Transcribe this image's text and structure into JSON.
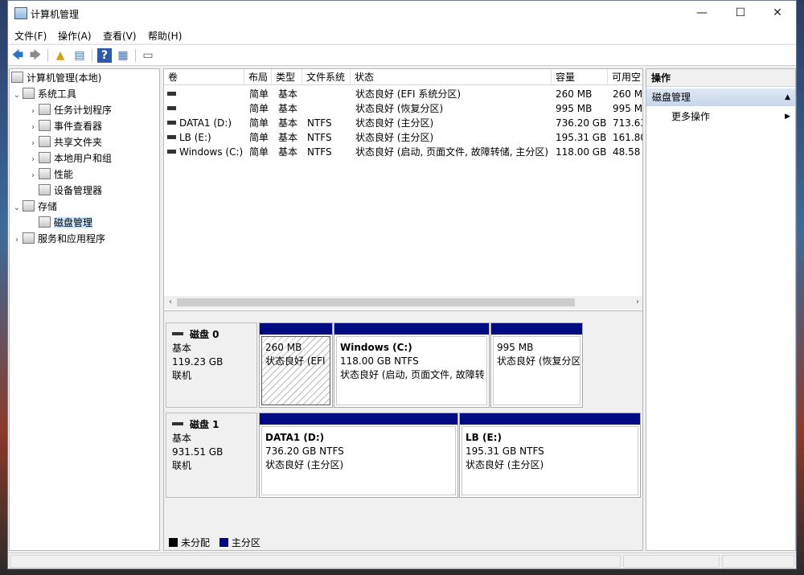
{
  "window": {
    "title": "计算机管理",
    "min": "—",
    "max": "☐",
    "close": "✕"
  },
  "menu": [
    "文件(F)",
    "操作(A)",
    "查看(V)",
    "帮助(H)"
  ],
  "toolbar": {
    "back": "🡄",
    "forward": "🡆",
    "up": "▲",
    "list": "▤",
    "help": "?",
    "props": "▦",
    "console": "▭"
  },
  "tree": {
    "root": "计算机管理(本地)",
    "system_tools": "系统工具",
    "items": [
      "任务计划程序",
      "事件查看器",
      "共享文件夹",
      "本地用户和组",
      "性能",
      "设备管理器"
    ],
    "storage": "存储",
    "disk_mgmt": "磁盘管理",
    "services": "服务和应用程序"
  },
  "volume_list": {
    "columns": [
      "卷",
      "布局",
      "类型",
      "文件系统",
      "状态",
      "容量",
      "可用空"
    ],
    "rows": [
      {
        "vol": "",
        "layout": "简单",
        "type": "基本",
        "fs": "",
        "status": "状态良好 (EFI 系统分区)",
        "cap": "260 MB",
        "free": "260 M"
      },
      {
        "vol": "",
        "layout": "简单",
        "type": "基本",
        "fs": "",
        "status": "状态良好 (恢复分区)",
        "cap": "995 MB",
        "free": "995 M"
      },
      {
        "vol": "DATA1 (D:)",
        "layout": "简单",
        "type": "基本",
        "fs": "NTFS",
        "status": "状态良好 (主分区)",
        "cap": "736.20 GB",
        "free": "713.63"
      },
      {
        "vol": "LB (E:)",
        "layout": "简单",
        "type": "基本",
        "fs": "NTFS",
        "status": "状态良好 (主分区)",
        "cap": "195.31 GB",
        "free": "161.80"
      },
      {
        "vol": "Windows (C:)",
        "layout": "简单",
        "type": "基本",
        "fs": "NTFS",
        "status": "状态良好 (启动, 页面文件, 故障转储, 主分区)",
        "cap": "118.00 GB",
        "free": "48.58"
      }
    ]
  },
  "disks": [
    {
      "name": "磁盘 0",
      "type": "基本",
      "size": "119.23 GB",
      "state": "联机",
      "partitions": [
        {
          "name": "",
          "size": "260 MB",
          "status": "状态良好 (EFI"
        },
        {
          "name": "Windows  (C:)",
          "size": "118.00 GB NTFS",
          "status": "状态良好 (启动, 页面文件, 故障转"
        },
        {
          "name": "",
          "size": "995 MB",
          "status": "状态良好 (恢复分区"
        }
      ]
    },
    {
      "name": "磁盘 1",
      "type": "基本",
      "size": "931.51 GB",
      "state": "联机",
      "partitions": [
        {
          "name": "DATA1  (D:)",
          "size": "736.20 GB NTFS",
          "status": "状态良好 (主分区)"
        },
        {
          "name": "LB  (E:)",
          "size": "195.31 GB NTFS",
          "status": "状态良好 (主分区)"
        }
      ]
    }
  ],
  "legend": {
    "unallocated": "未分配",
    "primary": "主分区",
    "unallocated_color": "#000000",
    "primary_color": "#000a82"
  },
  "actions": {
    "header": "操作",
    "section": "磁盘管理",
    "more": "更多操作"
  }
}
